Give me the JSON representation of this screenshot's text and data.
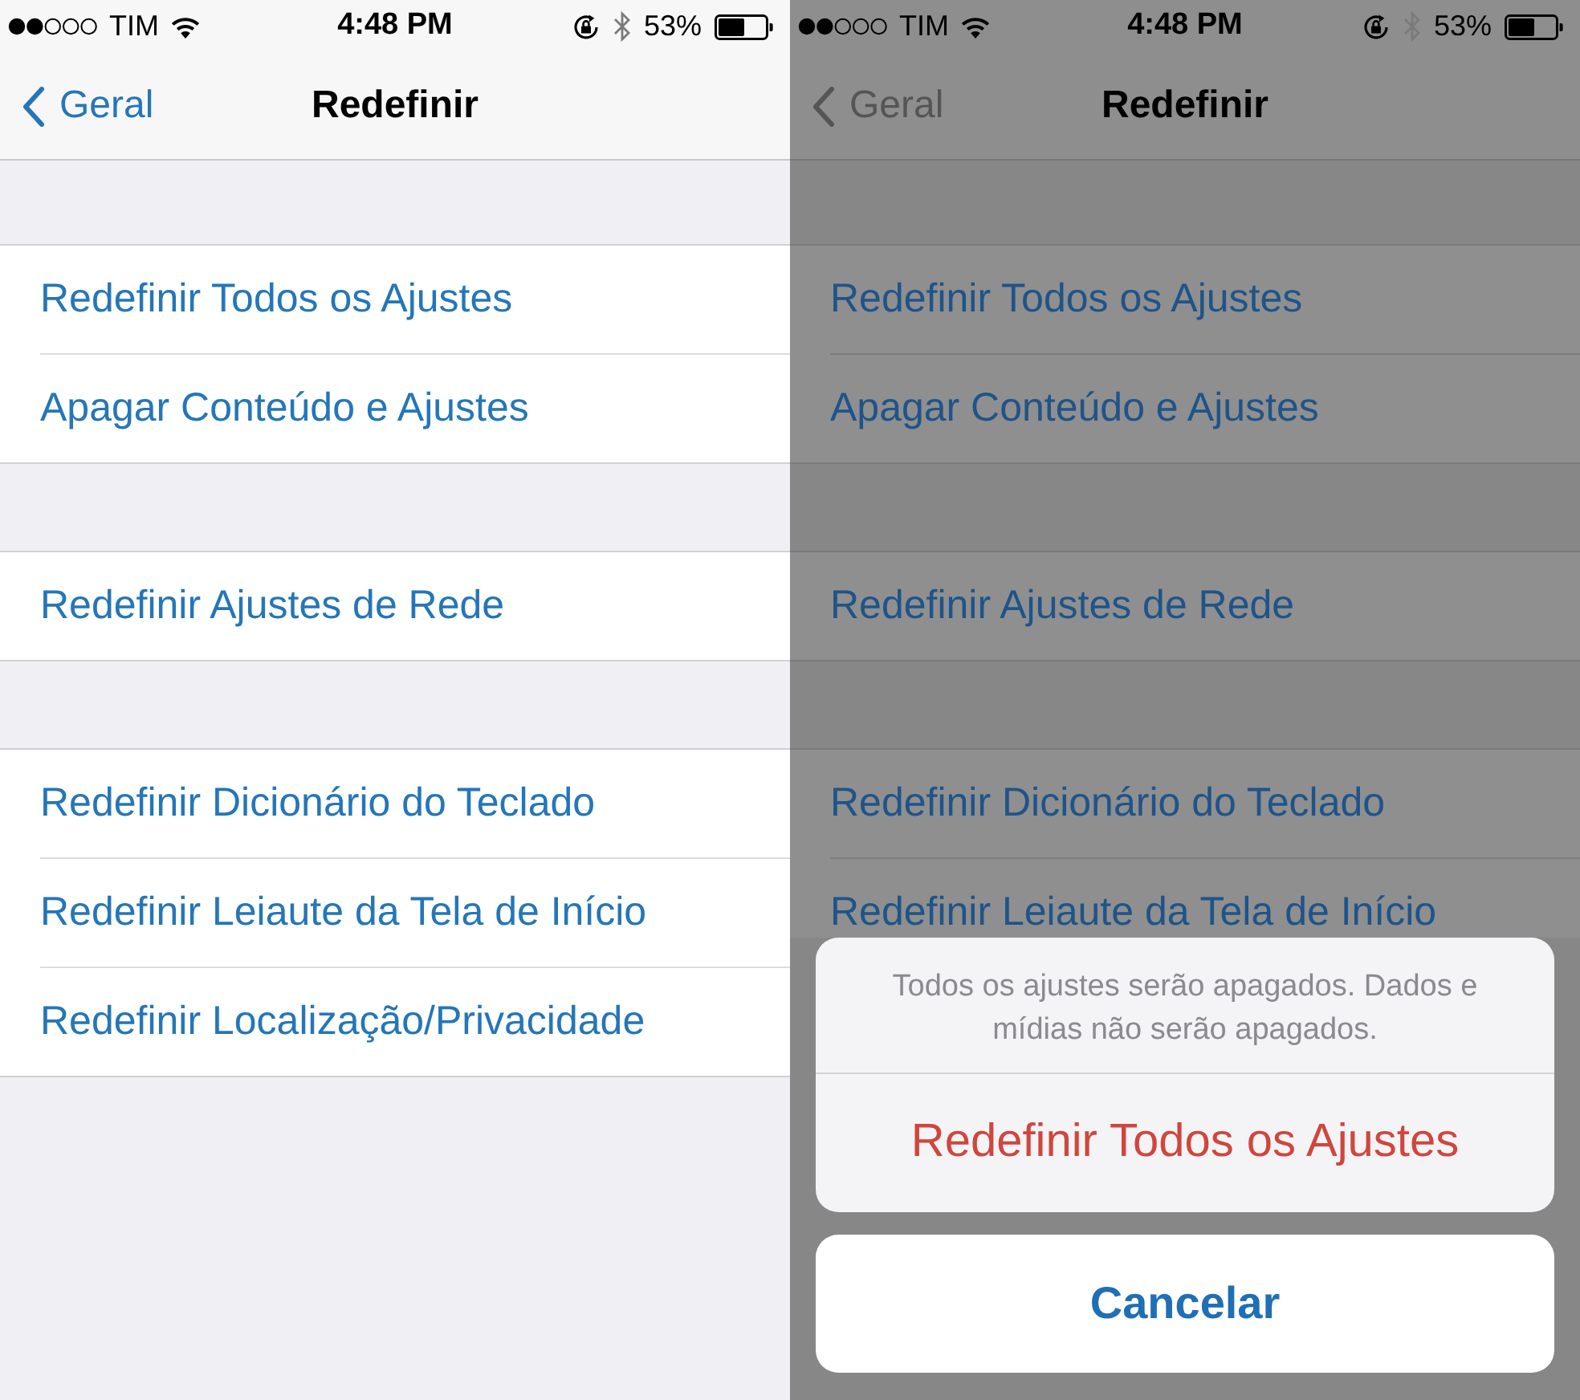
{
  "screens": [
    {
      "dimmed": false,
      "status_bar": {
        "carrier": "TIM",
        "time": "4:48 PM",
        "battery": "53%"
      },
      "nav": {
        "back": "Geral",
        "title": "Redefinir"
      },
      "groups": [
        {
          "rows": [
            "Redefinir Todos os Ajustes",
            "Apagar Conteúdo e Ajustes"
          ]
        },
        {
          "rows": [
            "Redefinir Ajustes de Rede"
          ]
        },
        {
          "rows": [
            "Redefinir Dicionário do Teclado",
            "Redefinir Leiaute da Tela de Início",
            "Redefinir Localização/Privacidade"
          ]
        }
      ]
    },
    {
      "dimmed": true,
      "status_bar": {
        "carrier": "TIM",
        "time": "4:48 PM",
        "battery": "53%"
      },
      "nav": {
        "back": "Geral",
        "title": "Redefinir"
      },
      "groups": [
        {
          "rows": [
            "Redefinir Todos os Ajustes",
            "Apagar Conteúdo e Ajustes"
          ]
        },
        {
          "rows": [
            "Redefinir Ajustes de Rede"
          ]
        },
        {
          "rows": [
            "Redefinir Dicionário do Teclado",
            "Redefinir Leiaute da Tela de Início"
          ]
        }
      ],
      "action_sheet": {
        "message": "Todos os ajustes serão apagados. Dados e mídias não serão apagados.",
        "actions": [
          {
            "label": "Redefinir Todos os Ajustes",
            "kind": "destructive"
          }
        ],
        "cancel": "Cancelar"
      }
    }
  ]
}
